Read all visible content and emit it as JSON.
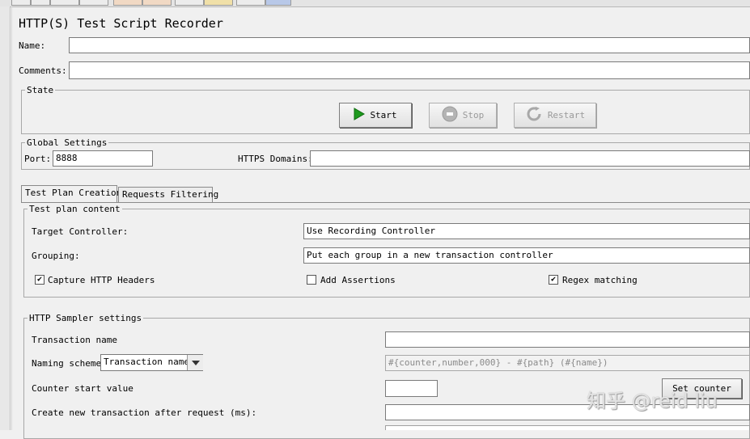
{
  "panel": {
    "title": "HTTP(S) Test Script Recorder",
    "name_label": "Name:",
    "name_value": "",
    "comments_label": "Comments:",
    "comments_value": ""
  },
  "state": {
    "legend": "State",
    "start_label": "Start",
    "stop_label": "Stop",
    "restart_label": "Restart"
  },
  "global_settings": {
    "legend": "Global Settings",
    "port_label": "Port:",
    "port_value": "8888",
    "https_domains_label": "HTTPS Domains:",
    "https_domains_value": ""
  },
  "tabs": [
    {
      "label": "Test Plan Creation",
      "active": true
    },
    {
      "label": "Requests Filtering",
      "active": false
    }
  ],
  "test_plan_content": {
    "legend": "Test plan content",
    "target_controller_label": "Target Controller:",
    "target_controller_value": "Use Recording Controller",
    "grouping_label": "Grouping:",
    "grouping_value": "Put each group in a new transaction controller",
    "capture_headers_label": "Capture HTTP Headers",
    "capture_headers_checked": true,
    "add_assertions_label": "Add Assertions",
    "add_assertions_checked": false,
    "regex_matching_label": "Regex matching",
    "regex_matching_checked": true
  },
  "http_sampler": {
    "legend": "HTTP Sampler settings",
    "transaction_name_label": "Transaction name",
    "transaction_name_value": "",
    "naming_scheme_label": "Naming scheme",
    "naming_scheme_value": "Transaction name",
    "naming_format_value": "#{counter,number,000} - #{path} (#{name})",
    "counter_start_label": "Counter start value",
    "counter_start_value": "",
    "set_counter_label": "Set counter",
    "create_new_transaction_label": "Create new transaction after request (ms):",
    "create_new_transaction_value": ""
  },
  "watermark": "知乎 @reid liu",
  "icons": {
    "start": "play-icon",
    "stop": "stop-icon",
    "restart": "restart-icon",
    "dropdown": "chevron-down-icon",
    "check": "checkmark-icon"
  },
  "colors": {
    "start_icon": "#1e9a1e",
    "disabled_icon": "#a8a8a8",
    "background": "#f0f0f0"
  }
}
